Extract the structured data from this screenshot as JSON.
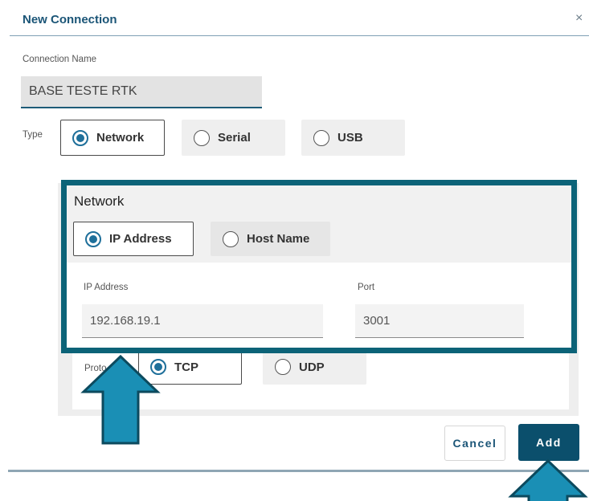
{
  "dialog": {
    "title": "New Connection",
    "close_glyph": "×"
  },
  "connection_name": {
    "label": "Connection Name",
    "value": "BASE TESTE RTK"
  },
  "type": {
    "label": "Type",
    "options": [
      {
        "label": "Network",
        "selected": true
      },
      {
        "label": "Serial",
        "selected": false
      },
      {
        "label": "USB",
        "selected": false
      }
    ]
  },
  "network": {
    "heading": "Network",
    "modes": [
      {
        "label": "IP Address",
        "selected": true
      },
      {
        "label": "Host Name",
        "selected": false
      }
    ],
    "ip_label": "IP Address",
    "ip_value": "192.168.19.1",
    "port_label": "Port",
    "port_value": "3001"
  },
  "protocol": {
    "label_visible": "Proto",
    "options": [
      {
        "label": "TCP",
        "selected": true
      },
      {
        "label": "UDP",
        "selected": false
      }
    ]
  },
  "buttons": {
    "cancel": "Cancel",
    "add": "Add"
  },
  "colors": {
    "accent": "#1e6f9a",
    "highlight_border": "#0c6378",
    "arrow_fill": "#1a8fb5",
    "add_bg": "#0b4f6c"
  },
  "icons": [
    "close-icon",
    "radio-icon",
    "arrow-up-icon"
  ]
}
